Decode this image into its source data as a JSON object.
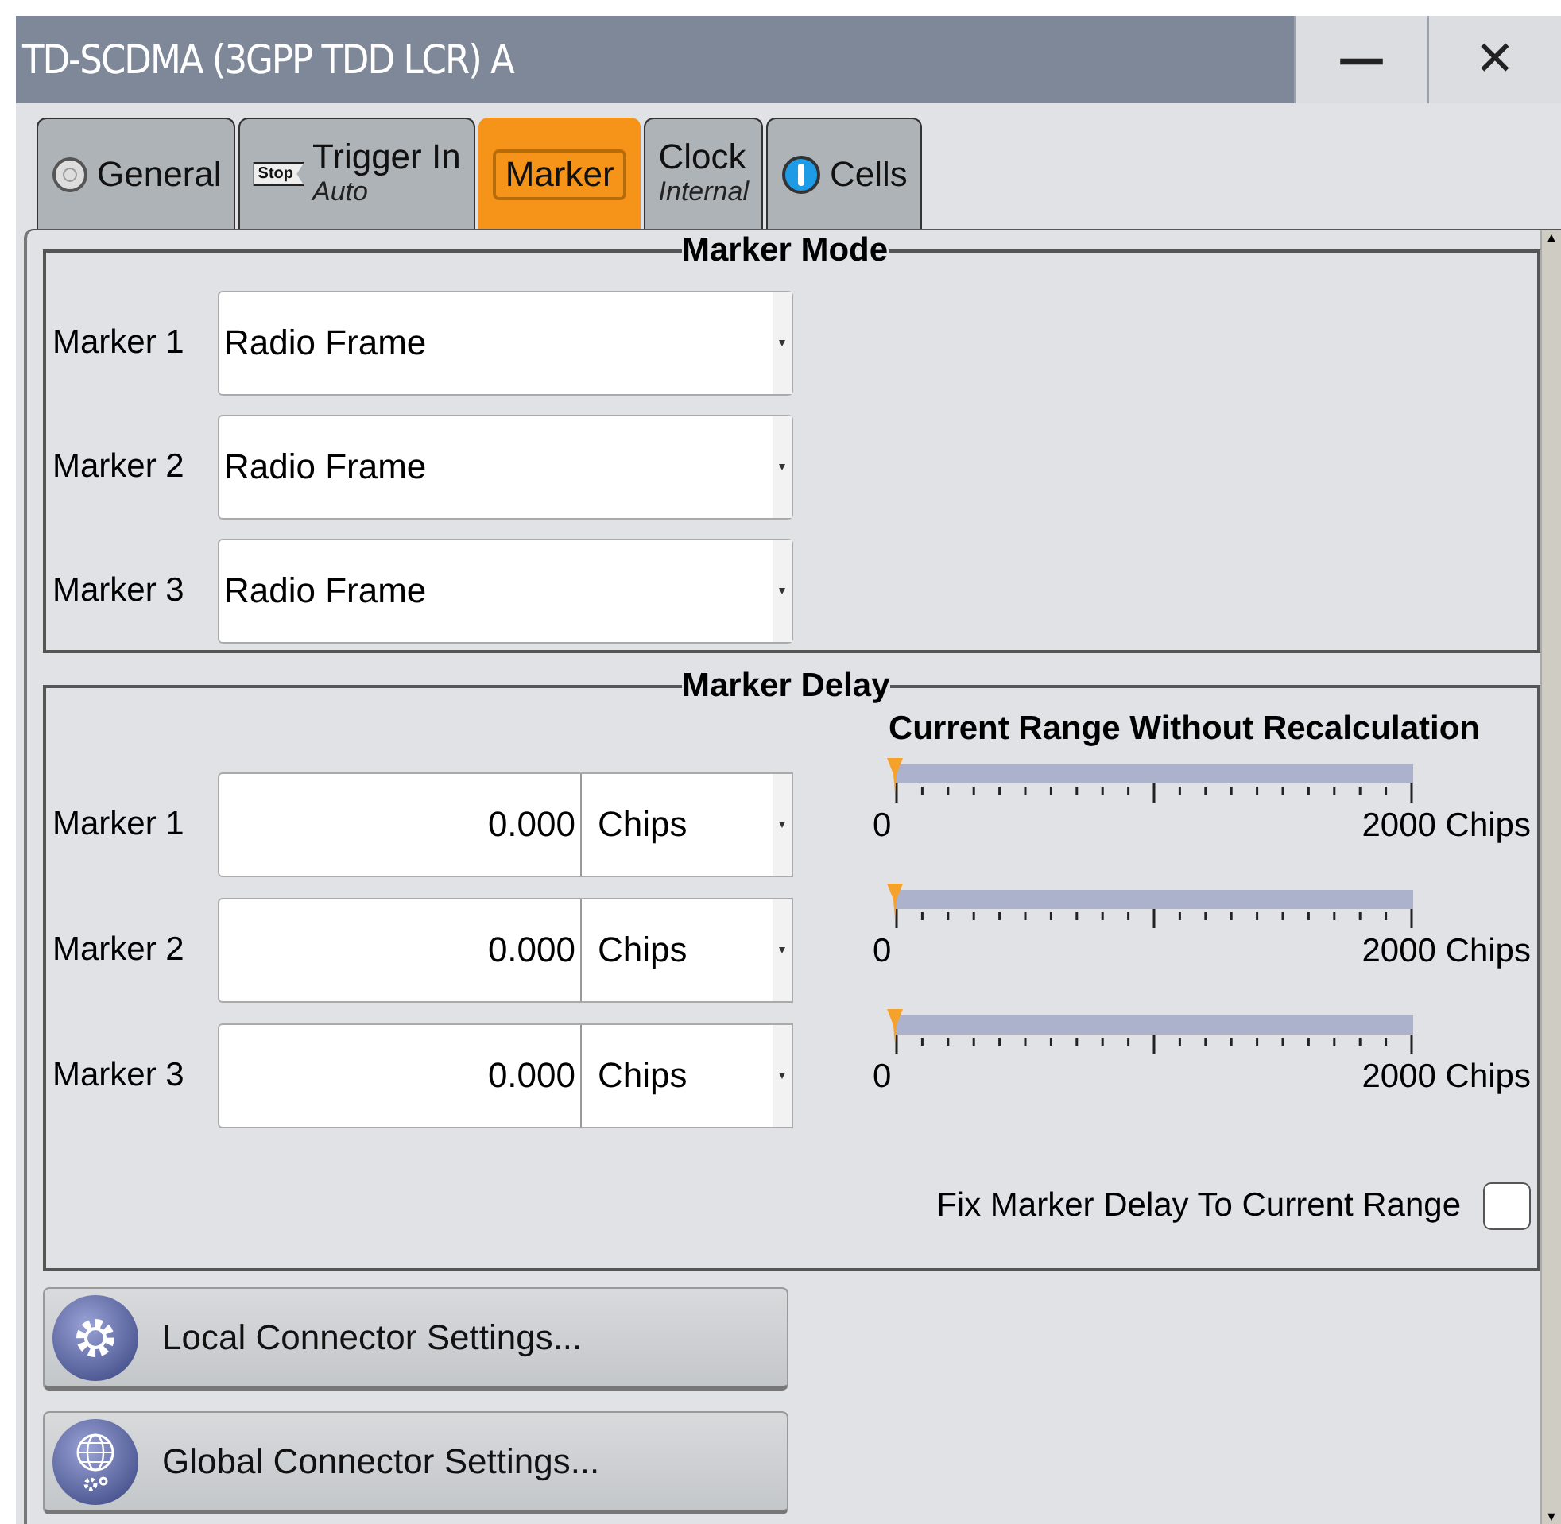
{
  "window": {
    "title": "TD-SCDMA (3GPP TDD LCR) A",
    "minimize_symbol": "—",
    "close_symbol": "✕"
  },
  "scrollbar": {
    "up_symbol": "▲",
    "down_symbol": "▼"
  },
  "tabs": [
    {
      "label": "General",
      "kind": "off",
      "selected": false
    },
    {
      "label": "Trigger In",
      "sublabel": "Auto",
      "kind": "stop",
      "icon_text": "Stop",
      "selected": false
    },
    {
      "label": "Marker",
      "kind": "plain",
      "selected": true
    },
    {
      "label": "Clock",
      "sublabel": "Internal",
      "kind": "plain",
      "selected": false
    },
    {
      "label": "Cells",
      "kind": "on",
      "selected": false
    }
  ],
  "marker_mode": {
    "title": "Marker Mode",
    "rows": [
      {
        "label": "Marker 1",
        "value": "Radio Frame"
      },
      {
        "label": "Marker 2",
        "value": "Radio Frame"
      },
      {
        "label": "Marker 3",
        "value": "Radio Frame"
      }
    ]
  },
  "marker_delay": {
    "title": "Marker Delay",
    "range_title": "Current Range Without Recalculation",
    "rows": [
      {
        "label": "Marker 1",
        "value": "0.000",
        "unit": "Chips",
        "level": 0,
        "min_label": "0",
        "max_label": "2000 Chips"
      },
      {
        "label": "Marker 2",
        "value": "0.000",
        "unit": "Chips",
        "level": 0,
        "min_label": "0",
        "max_label": "2000 Chips"
      },
      {
        "label": "Marker 3",
        "value": "0.000",
        "unit": "Chips",
        "level": 0,
        "min_label": "0",
        "max_label": "2000 Chips"
      }
    ],
    "fix_label": "Fix Marker Delay To Current Range",
    "fix_checked": false
  },
  "buttons": [
    {
      "label": "Local Connector Settings...",
      "kind": "local"
    },
    {
      "label": "Global Connector Settings...",
      "kind": "global"
    }
  ]
}
